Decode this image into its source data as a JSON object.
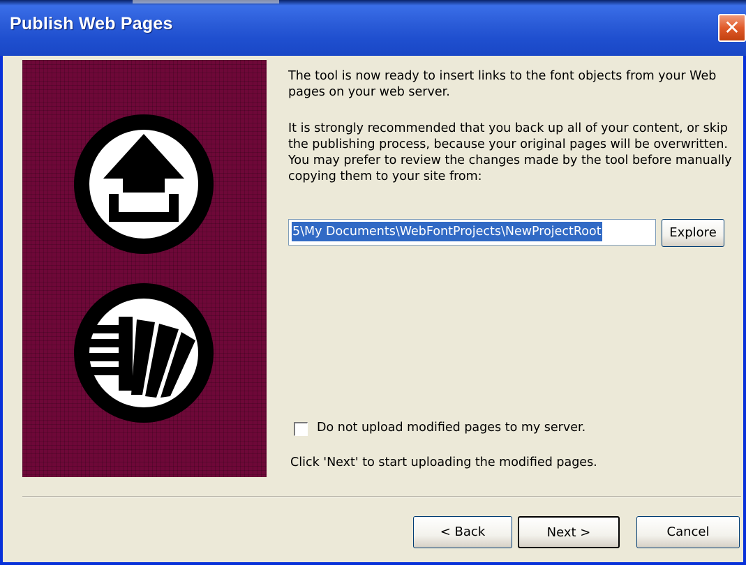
{
  "window": {
    "title": "Publish Web Pages"
  },
  "main": {
    "intro": "The tool is now ready to insert links to the font objects from your Web pages on your web server.",
    "warning": "It is strongly recommended that you back up all of your content, or skip the publishing process, because your original pages will be overwritten. You may prefer to review the changes made by the tool before manually copying them to your site from:",
    "path_value": "5\\My Documents\\WebFontProjects\\NewProjectRoot",
    "explore_label": "Explore",
    "checkbox_label": "Do not upload modified pages to my server.",
    "checkbox_checked": false,
    "hint": "Click 'Next' to start uploading the modified pages."
  },
  "buttons": {
    "back": "< Back",
    "next": "Next >",
    "cancel": "Cancel"
  },
  "icons": {
    "close": "close-icon",
    "upload": "upload-icon",
    "pages": "pages-icon"
  },
  "colors": {
    "title_bar": "#2a5bd7",
    "side_panel": "#6e0838",
    "selection": "#316ac5",
    "close_button": "#e05a2a"
  }
}
